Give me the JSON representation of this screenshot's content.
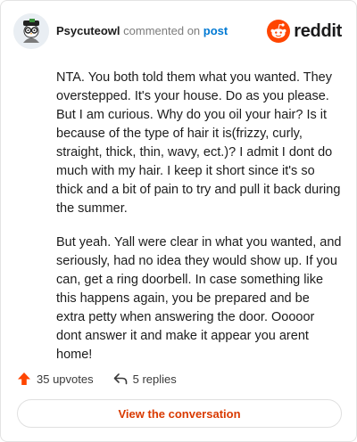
{
  "header": {
    "username": "Psycuteowl",
    "action_text": "commented on",
    "post_link": "post",
    "logo_text": "reddit"
  },
  "comment": {
    "paragraphs": [
      "NTA. You both told them what you wanted. They overstepped. It's your house. Do as you please. But I am curious. Why do you oil your hair? Is it because of the type of hair it is(frizzy, curly, straight, thick, thin, wavy, ect.)? I admit I dont do much with my hair. I keep it short since it's so thick and a bit of pain to try and pull it back during the summer.",
      "But yeah. Yall were clear in what you wanted, and seriously, had no idea they would show up. If you can, get a ring doorbell. In case something like this happens again, you be prepared and be extra petty when answering the door. Ooooor dont answer it and make it appear you arent home!"
    ]
  },
  "footer": {
    "upvotes": "35 upvotes",
    "replies": "5 replies"
  },
  "cta": {
    "label": "View the conversation"
  },
  "colors": {
    "brand": "#ff4500",
    "link": "#0079d3",
    "cta_text": "#d93a00"
  }
}
